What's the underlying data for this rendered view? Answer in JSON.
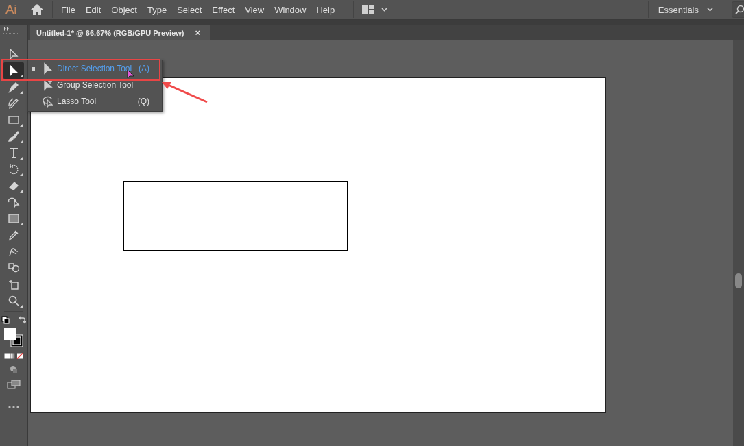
{
  "app": {
    "logo": "Ai"
  },
  "menu": [
    "File",
    "Edit",
    "Object",
    "Type",
    "Select",
    "Effect",
    "View",
    "Window",
    "Help"
  ],
  "workspace": {
    "label": "Essentials"
  },
  "document_tab": {
    "title": "Untitled-1* @ 66.67% (RGB/GPU Preview)",
    "close": "×"
  },
  "tools": [
    {
      "kind": "selection",
      "selected": false,
      "grouped": false
    },
    {
      "kind": "direct-selection",
      "selected": true,
      "grouped": true
    },
    {
      "kind": "pen",
      "selected": false,
      "grouped": true
    },
    {
      "kind": "curvature",
      "selected": false,
      "grouped": false
    },
    {
      "kind": "rectangle",
      "selected": false,
      "grouped": true
    },
    {
      "kind": "paintbrush",
      "selected": false,
      "grouped": true
    },
    {
      "kind": "type",
      "selected": false,
      "grouped": true
    },
    {
      "kind": "rotate",
      "selected": false,
      "grouped": true
    },
    {
      "kind": "eraser",
      "selected": false,
      "grouped": true
    },
    {
      "kind": "shape-builder",
      "selected": false,
      "grouped": false
    },
    {
      "kind": "gradient",
      "selected": false,
      "grouped": true
    },
    {
      "kind": "eyedropper",
      "selected": false,
      "grouped": false
    },
    {
      "kind": "puppet-warp",
      "selected": false,
      "grouped": false
    },
    {
      "kind": "blend",
      "selected": false,
      "grouped": false
    },
    {
      "kind": "artboard",
      "selected": false,
      "grouped": false
    },
    {
      "kind": "zoom",
      "selected": false,
      "grouped": true
    }
  ],
  "flyout": [
    {
      "kind": "direct-selection",
      "label": "Direct Selection Tool",
      "shortcut": "(A)",
      "selected": true
    },
    {
      "kind": "group-selection",
      "label": "Group Selection Tool",
      "selected": false
    },
    {
      "kind": "lasso",
      "label": "Lasso Tool",
      "shortcut": "(Q)",
      "selected": false
    }
  ]
}
